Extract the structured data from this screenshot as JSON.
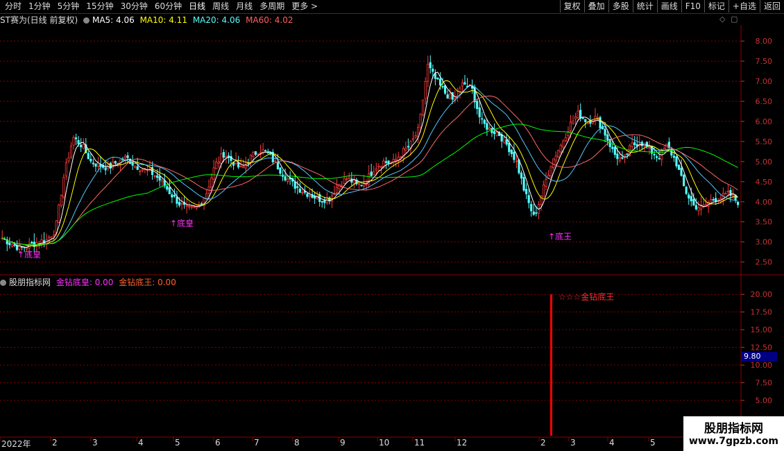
{
  "toolbar": {
    "periods": [
      "分时",
      "1分钟",
      "5分钟",
      "15分钟",
      "30分钟",
      "60分钟",
      "日线",
      "周线",
      "月线",
      "多周期",
      "更多 >"
    ],
    "active_period": "日线",
    "tools": [
      "复权",
      "叠加",
      "多股",
      "统计",
      "画线",
      "F10",
      "标记",
      "+自选",
      "返回"
    ]
  },
  "main_legend": {
    "title": "ST赛为(日线 前复权)",
    "ma5": "MA5: 4.06",
    "ma10": "MA10: 4.11",
    "ma20": "MA20: 4.06",
    "ma60": "MA60: 4.02"
  },
  "main_axis": [
    "8.00",
    "7.50",
    "7.00",
    "6.50",
    "6.00",
    "5.50",
    "5.00",
    "4.50",
    "4.00",
    "3.50",
    "3.00",
    "2.50"
  ],
  "markers": [
    {
      "label": "底皇"
    },
    {
      "label": "底皇"
    },
    {
      "label": "底王"
    }
  ],
  "indicator_legend": {
    "title": "股朋指标网",
    "series1": "金钻底皇: 0.00",
    "series2": "金钻底王: 0.00"
  },
  "indicator_axis": [
    "20.00",
    "17.50",
    "15.00",
    "12.50",
    "10.00",
    "7.50",
    "5.00"
  ],
  "indicator_signal": "☆☆☆金钻底王",
  "indicator_value_tag": "9.80",
  "x_labels": [
    "2022年",
    "2",
    "3",
    "4",
    "5",
    "6",
    "7",
    "8",
    "9",
    "10",
    "11",
    "12",
    "2",
    "3",
    "4",
    "5"
  ],
  "watermark": {
    "line1": "股朋指标网",
    "line2": "www.7gpzb.com"
  },
  "colors": {
    "up": "#ff3b3b",
    "down": "#54ffff",
    "ma5": "#ffffff",
    "ma10": "#ffff00",
    "ma20": "#ff50ff",
    "ma60": "#00ff00",
    "grid": "#8b0000",
    "axis": "#c83232",
    "signal": "#ff0000"
  },
  "chart_data": {
    "type": "candlestick",
    "close_path": [
      3.1,
      2.95,
      2.85,
      2.9,
      3.0,
      3.05,
      3.3,
      4.7,
      5.6,
      5.4,
      5.0,
      4.9,
      4.85,
      5.0,
      5.1,
      4.9,
      4.8,
      4.7,
      4.5,
      4.2,
      3.95,
      3.8,
      3.85,
      4.2,
      4.9,
      5.2,
      5.0,
      4.8,
      5.1,
      5.3,
      5.2,
      4.9,
      4.6,
      4.4,
      4.25,
      4.15,
      4.05,
      4.1,
      4.45,
      4.6,
      4.4,
      4.5,
      4.85,
      5.0,
      4.95,
      5.2,
      5.4,
      5.8,
      7.4,
      7.0,
      6.7,
      6.5,
      6.95,
      6.8,
      6.0,
      5.8,
      5.7,
      5.4,
      5.0,
      4.2,
      3.6,
      4.3,
      5.0,
      5.4,
      5.9,
      6.2,
      6.0,
      6.1,
      5.7,
      5.2,
      5.0,
      5.4,
      5.5,
      5.3,
      5.1,
      5.4,
      5.0,
      4.3,
      3.9,
      3.85,
      4.05,
      4.1,
      4.2,
      4.0
    ],
    "ma5_last": 4.06,
    "ma10_last": 4.11,
    "ma20_last": 4.06,
    "ma60_last": 4.02,
    "ylim": [
      2.2,
      8.4
    ],
    "indicator_ylim": [
      0,
      21
    ],
    "signal_value": 20.0
  }
}
